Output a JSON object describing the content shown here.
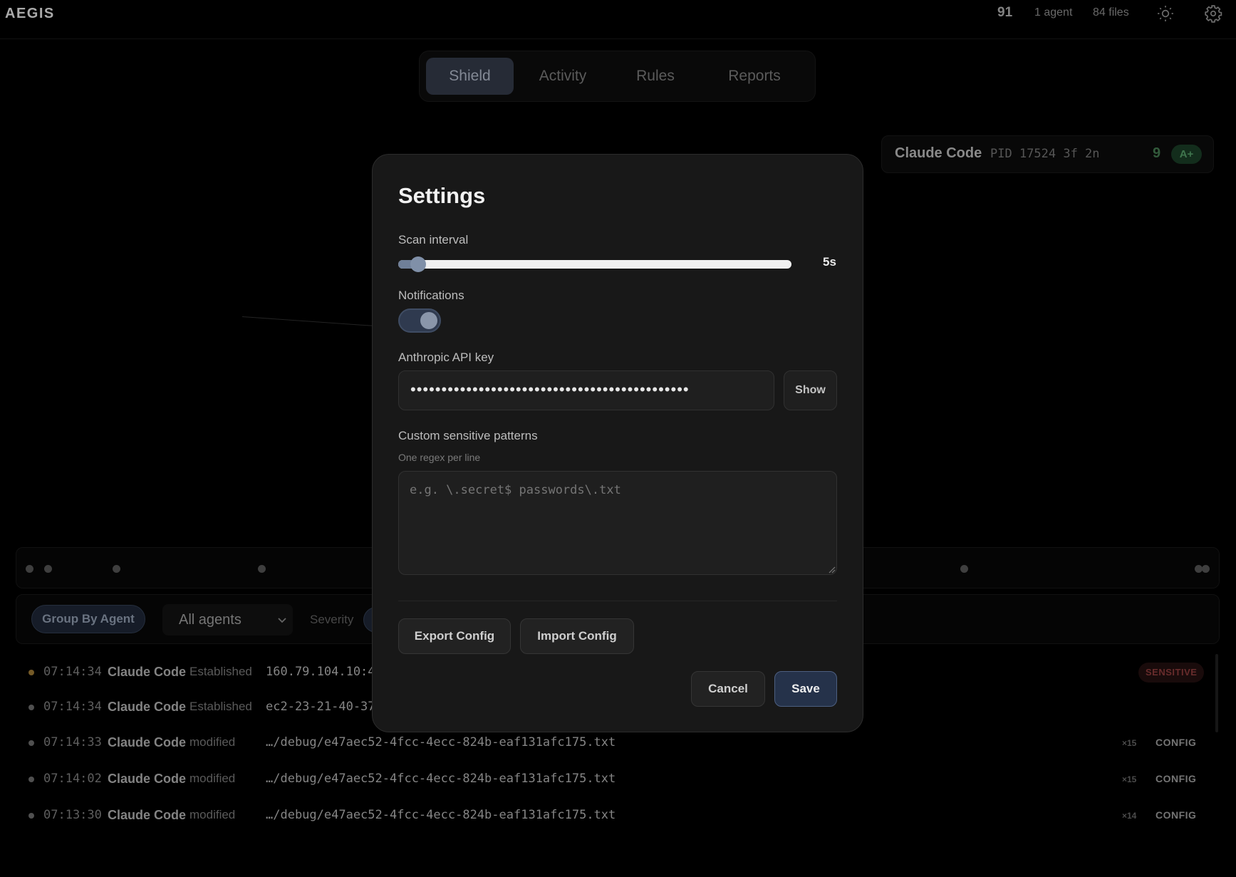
{
  "app": {
    "brand": "AEGIS"
  },
  "topbar": {
    "score": "91",
    "agents": "1 agent",
    "files": "84 files",
    "theme_icon": "sun-icon",
    "settings_icon": "gear-icon"
  },
  "tabs": [
    {
      "label": "Shield",
      "active": true
    },
    {
      "label": "Activity",
      "active": false
    },
    {
      "label": "Rules",
      "active": false
    },
    {
      "label": "Reports",
      "active": false
    }
  ],
  "agent_card": {
    "name": "Claude Code",
    "meta": "PID 17524 3f 2n",
    "score": "9",
    "grade": "A+"
  },
  "filters": {
    "group_by": "Group By Agent",
    "agent_select": "All agents",
    "severity_label": "Severity"
  },
  "events": [
    {
      "time": "07:14:34",
      "agent": "Claude Code",
      "action": "Established",
      "target": "160.79.104.10:4",
      "count": "",
      "tag": "SENSITIVE",
      "severity": "warn"
    },
    {
      "time": "07:14:34",
      "agent": "Claude Code",
      "action": "Established",
      "target": "ec2-23-21-40-37",
      "count": "",
      "tag": "",
      "severity": "normal"
    },
    {
      "time": "07:14:33",
      "agent": "Claude Code",
      "action": "modified",
      "target": "…/debug/e47aec52-4fcc-4ecc-824b-eaf131afc175.txt",
      "count": "×15",
      "tag": "CONFIG",
      "severity": "normal"
    },
    {
      "time": "07:14:02",
      "agent": "Claude Code",
      "action": "modified",
      "target": "…/debug/e47aec52-4fcc-4ecc-824b-eaf131afc175.txt",
      "count": "×15",
      "tag": "CONFIG",
      "severity": "normal"
    },
    {
      "time": "07:13:30",
      "agent": "Claude Code",
      "action": "modified",
      "target": "…/debug/e47aec52-4fcc-4ecc-824b-eaf131afc175.txt",
      "count": "×14",
      "tag": "CONFIG",
      "severity": "normal"
    }
  ],
  "settings": {
    "title": "Settings",
    "scan_interval": {
      "label": "Scan interval",
      "value_label": "5s",
      "fraction": 0.05
    },
    "notifications": {
      "label": "Notifications",
      "enabled": true
    },
    "api_key": {
      "label": "Anthropic API key",
      "masked_value": "•••••••••••••••••••••••••••••••••••••••••••••",
      "show_label": "Show"
    },
    "patterns": {
      "label": "Custom sensitive patterns",
      "hint": "One regex per line",
      "placeholder": "e.g. \\.secret$ passwords\\.txt"
    },
    "export_label": "Export Config",
    "import_label": "Import Config",
    "cancel_label": "Cancel",
    "save_label": "Save"
  },
  "colors": {
    "accent": "#25324a",
    "sensitive": "#7b3434",
    "grade_good": "#4b8a5b"
  }
}
